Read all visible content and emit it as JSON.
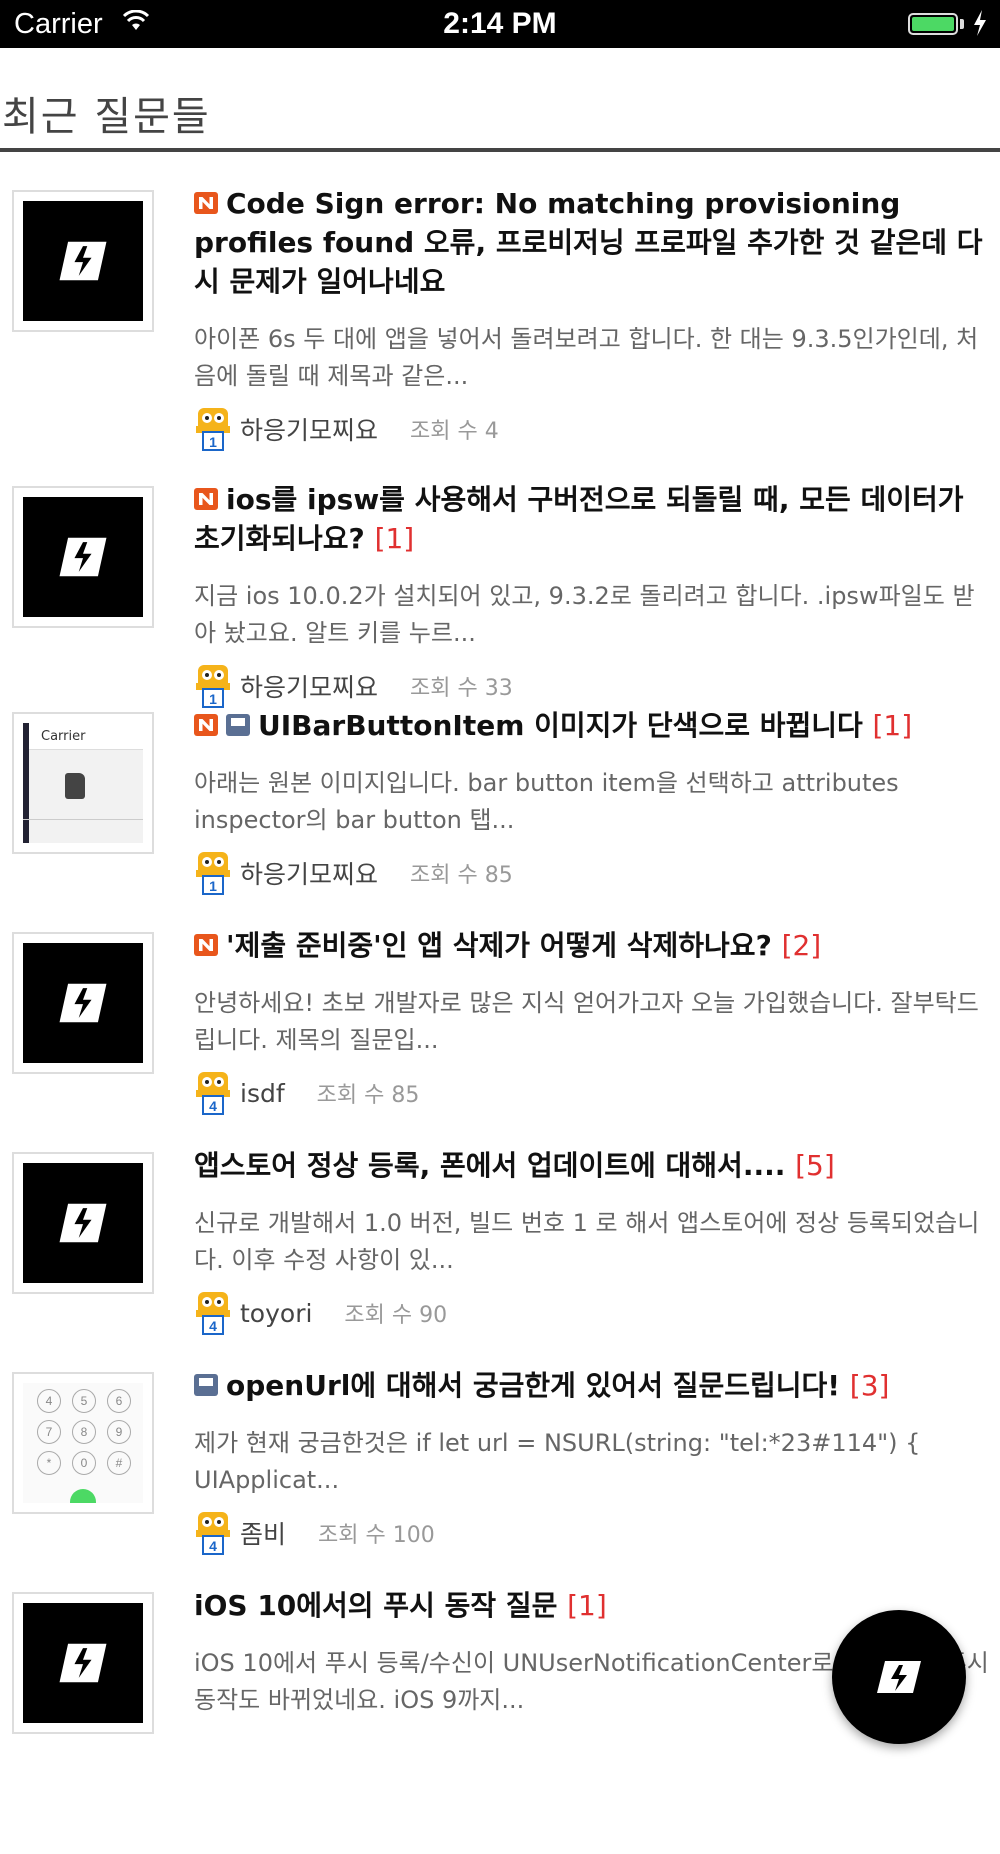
{
  "status_bar": {
    "carrier": "Carrier",
    "time": "2:14 PM",
    "battery_level": 1.0
  },
  "page": {
    "title": "최근 질문들"
  },
  "questions": [
    {
      "title": "Code Sign error: No matching provisioning profiles found 오류, 프로비저닝 프로파일 추가한 것 같은데 다시 문제가 일어나네요",
      "answers": "",
      "tags": [
        "n-icon"
      ],
      "thumb": "logo",
      "excerpt": "아이폰 6s 두 대에 앱을 넣어서 돌려보려고 합니다. 한 대는 9.3.5인가인데, 처음에 돌릴 때 제목과 같은...",
      "author": "하응기모찌요",
      "level": "1",
      "views": "조회 수 4"
    },
    {
      "title": "ios를 ipsw를 사용해서 구버전으로 되돌릴 때, 모든 데이터가 초기화되나요?",
      "answers": "[1]",
      "tags": [
        "n-icon"
      ],
      "thumb": "logo",
      "excerpt": "지금 ios 10.0.2가 설치되어 있고, 9.3.2로 돌리려고 합니다. .ipsw파일도 받아 놨고요. 알트 키를 누르...",
      "author": "하응기모찌요",
      "level": "1",
      "views": "조회 수 33"
    },
    {
      "title": "UIBarButtonItem 이미지가 단색으로 바뀝니다",
      "answers": "[1]",
      "tags": [
        "n-icon",
        "file-icon"
      ],
      "thumb": "screenshot",
      "thumb_label": "Carrier",
      "excerpt": "아래는 원본 이미지입니다. bar button item을 선택하고 attributes inspector의 bar button 탭...",
      "author": "하응기모찌요",
      "level": "1",
      "views": "조회 수 85"
    },
    {
      "title": "'제출 준비중'인 앱 삭제가 어떻게 삭제하나요?",
      "answers": "[2]",
      "tags": [
        "n-icon"
      ],
      "thumb": "logo",
      "excerpt": "안녕하세요!   초보 개발자로 많은 지식 얻어가고자 오늘 가입했습니다. 잘부탁드립니다. 제목의 질문입...",
      "author": "isdf",
      "level": "4",
      "views": "조회 수 85"
    },
    {
      "title": "앱스토어 정상 등록, 폰에서 업데이트에 대해서....",
      "answers": "[5]",
      "tags": [],
      "thumb": "logo",
      "excerpt": "신규로 개발해서 1.0 버전, 빌드 번호 1 로 해서 앱스토어에 정상 등록되었습니다. 이후 수정 사항이 있...",
      "author": "toyori",
      "level": "4",
      "views": "조회 수 90"
    },
    {
      "title": "openUrl에 대해서 궁금한게 있어서 질문드립니다!",
      "answers": "[3]",
      "tags": [
        "file-icon"
      ],
      "thumb": "dialpad",
      "thumb_keys": [
        "4",
        "5",
        "6",
        "7",
        "8",
        "9",
        "*",
        "0",
        "#"
      ],
      "excerpt": "제가 현재 궁금한것은          if let url = NSURL(string: \"tel:*23#114\") {            UIApplicat...",
      "author": "좀비",
      "level": "4",
      "views": "조회 수 100"
    },
    {
      "title": "iOS 10에서의 푸시 동작 질문",
      "answers": "[1]",
      "tags": [],
      "thumb": "logo",
      "excerpt": "iOS 10에서 푸시 등록/수신이 UNUserNotificationCenter로 바뀌었고, 푸시 동작도 바뀌었네요. iOS 9까지...",
      "author": "",
      "level": "",
      "views": ""
    }
  ],
  "fab": {
    "icon": "logo-icon"
  }
}
